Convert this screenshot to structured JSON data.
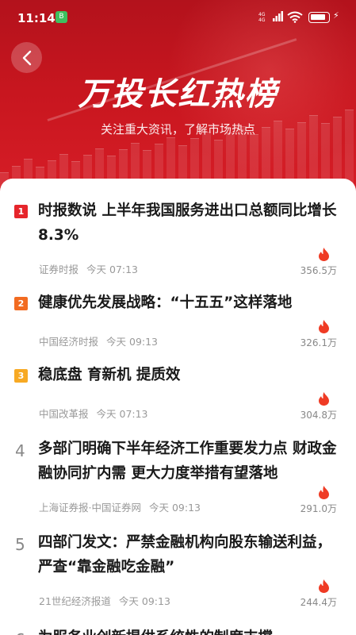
{
  "status_bar": {
    "time": "11:14",
    "app_badge": "B",
    "signal_text": "4G\n4G"
  },
  "header": {
    "title": "万投长红热榜",
    "subtitle": "关注重大资讯，了解市场热点"
  },
  "colors": {
    "brand_red": "#c8161f",
    "rank1": "#e6252b",
    "rank2": "#f26b21",
    "rank3": "#f7a923",
    "flame": "#ef3b24"
  },
  "news": [
    {
      "rank": "1",
      "title": "时报数说 上半年我国服务进出口总额同比增长8.3%",
      "source": "证券时报",
      "time": "今天 07:13",
      "heat": "356.5万"
    },
    {
      "rank": "2",
      "title": "健康优先发展战略：“十五五”这样落地",
      "source": "中国经济时报",
      "time": "今天 09:13",
      "heat": "326.1万"
    },
    {
      "rank": "3",
      "title": "稳底盘 育新机 提质效",
      "source": "中国改革报",
      "time": "今天 07:13",
      "heat": "304.8万"
    },
    {
      "rank": "4",
      "title": "多部门明确下半年经济工作重要发力点 财政金融协同扩内需 更大力度举措有望落地",
      "source": "上海证券报·中国证券网",
      "time": "今天 09:13",
      "heat": "291.0万"
    },
    {
      "rank": "5",
      "title": "四部门发文：严禁金融机构向股东输送利益，严查“靠金融吃金融”",
      "source": "21世纪经济报道",
      "time": "今天 09:13",
      "heat": "244.4万"
    },
    {
      "rank": "6",
      "title": "为服务业创新提供系统性的制度支撑",
      "source": "",
      "time": "",
      "heat": ""
    }
  ]
}
